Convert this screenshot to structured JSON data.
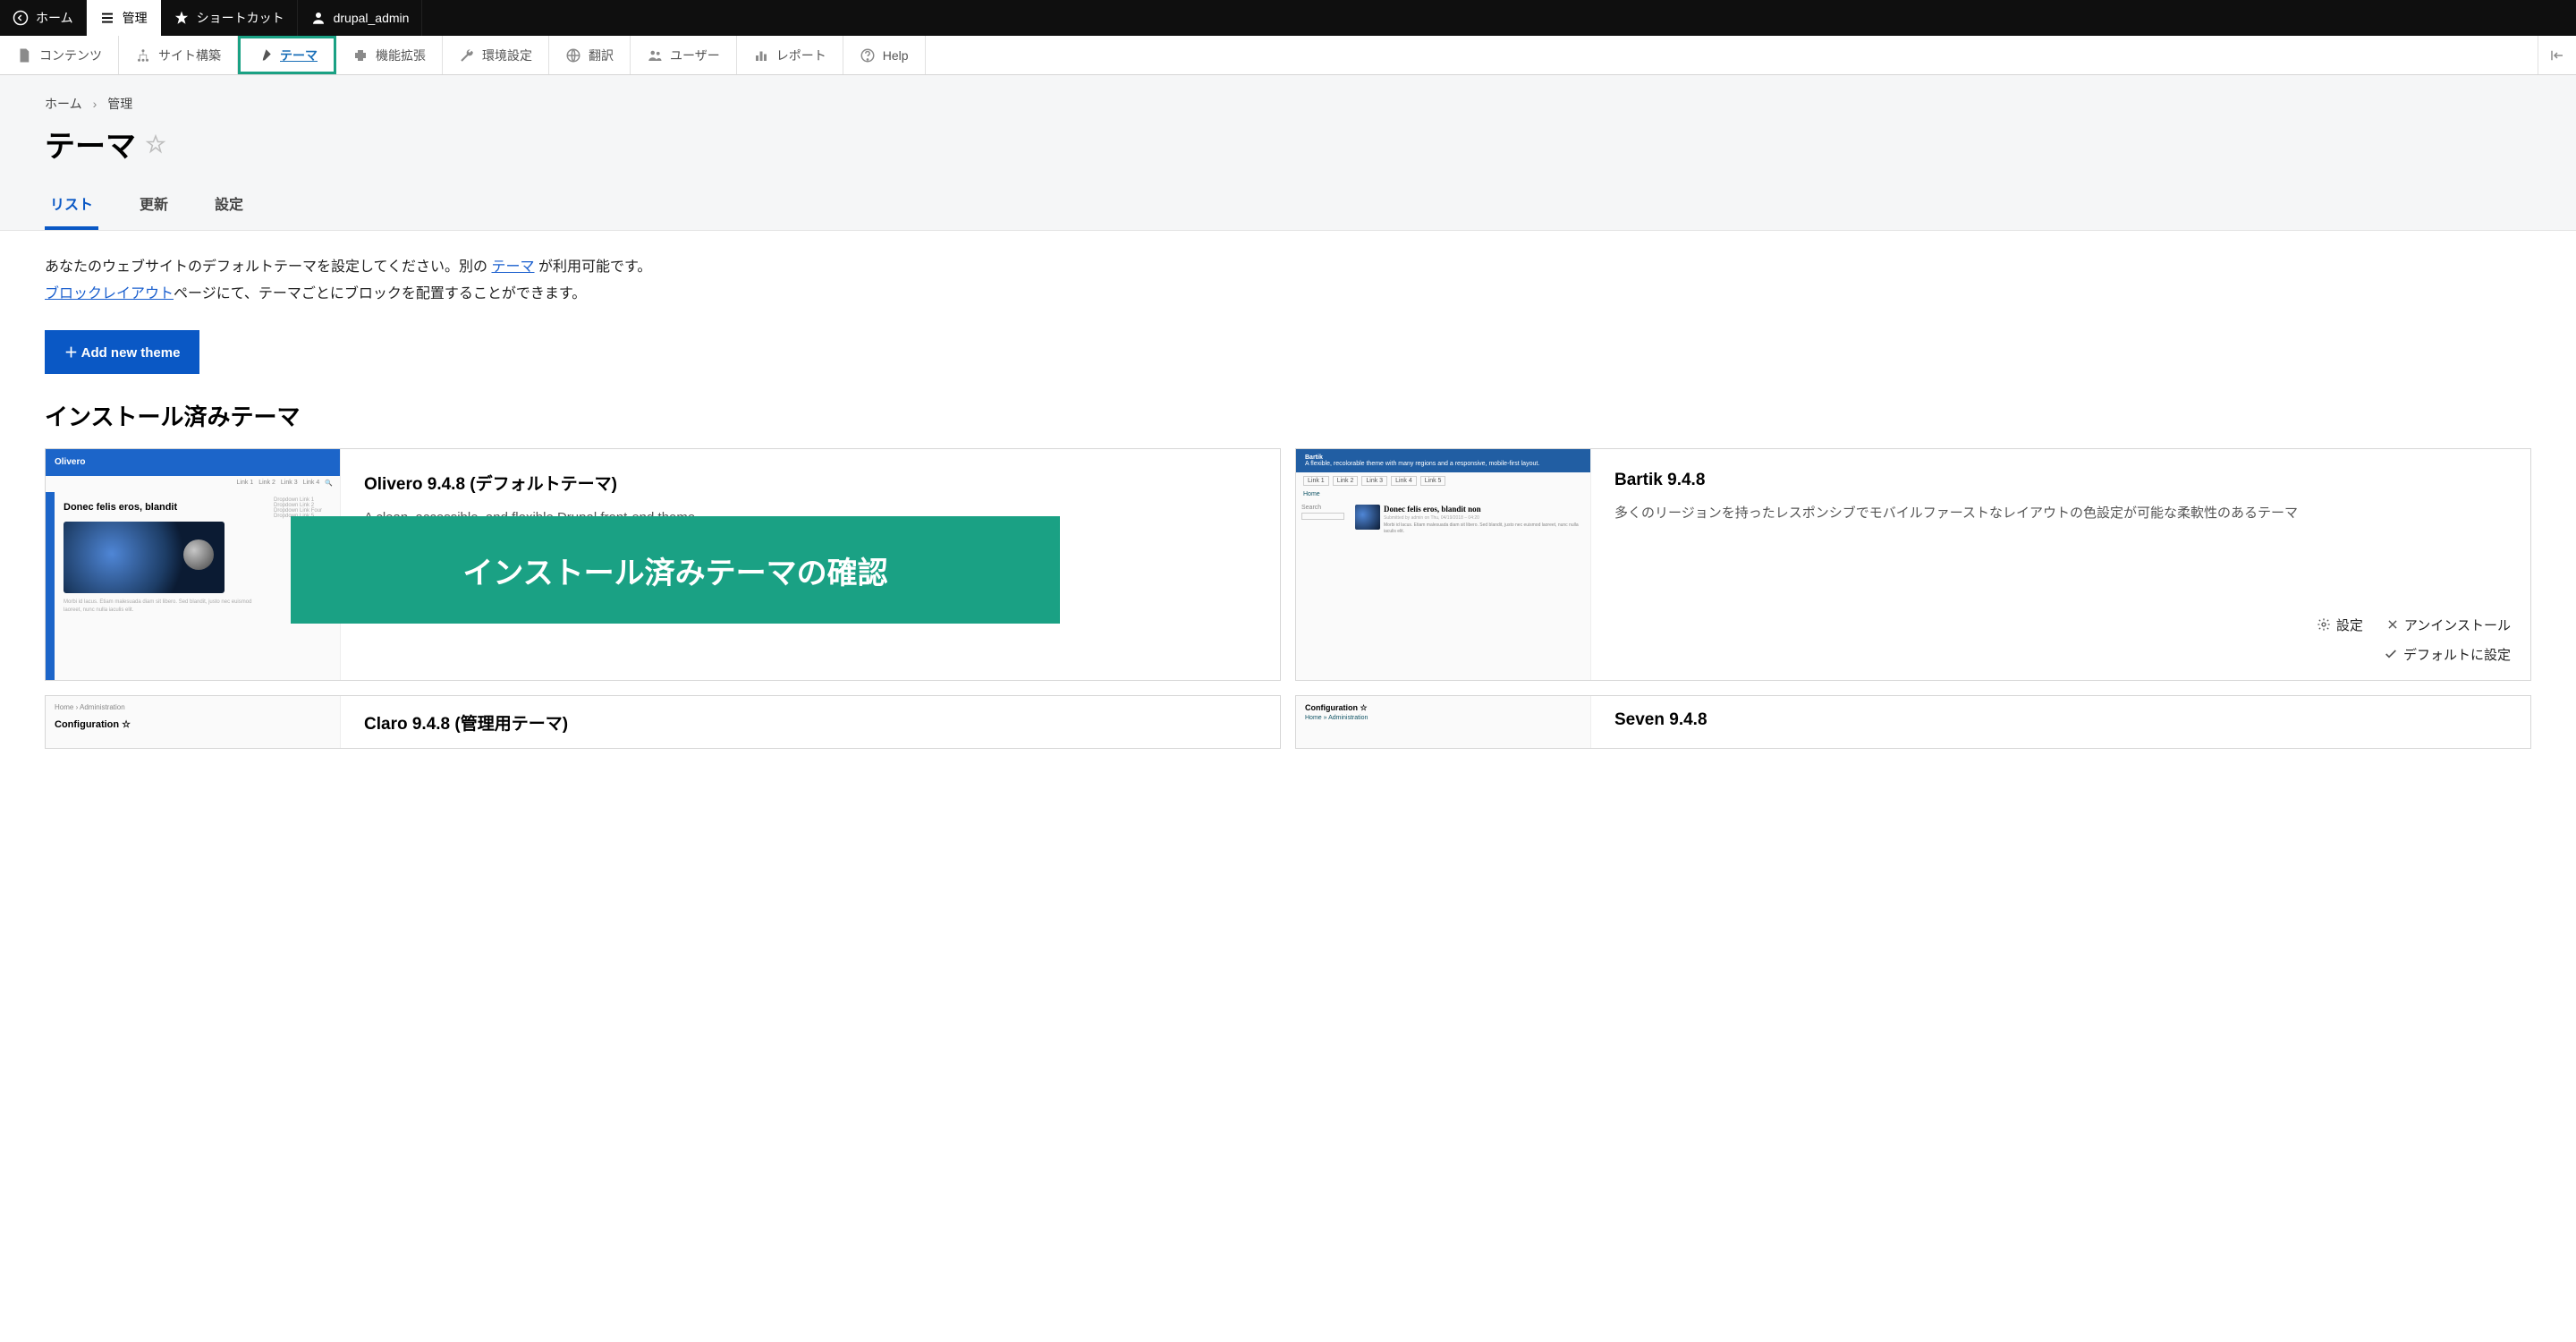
{
  "toolbar": {
    "home": "ホーム",
    "manage": "管理",
    "shortcuts": "ショートカット",
    "user": "drupal_admin"
  },
  "admin_menu": {
    "items": [
      {
        "label": "コンテンツ"
      },
      {
        "label": "サイト構築"
      },
      {
        "label": "テーマ"
      },
      {
        "label": "機能拡張"
      },
      {
        "label": "環境設定"
      },
      {
        "label": "翻訳"
      },
      {
        "label": "ユーザー"
      },
      {
        "label": "レポート"
      },
      {
        "label": "Help"
      }
    ]
  },
  "breadcrumb": {
    "home": "ホーム",
    "sep": "›",
    "manage": "管理"
  },
  "page_title": "テーマ",
  "tabs": {
    "list": "リスト",
    "update": "更新",
    "settings": "設定"
  },
  "desc": {
    "line1_pre": "あなたのウェブサイトのデフォルトテーマを設定してください。別の ",
    "line1_link": "テーマ",
    "line1_post": " が利用可能です。",
    "line2_link": "ブロックレイアウト",
    "line2_post": "ページにて、テーマごとにブロックを配置することができます。"
  },
  "add_button": "＋ Add new theme",
  "installed_heading": "インストール済みテーマ",
  "overlay": "インストール済みテーマの確認",
  "actions": {
    "settings": "設定",
    "uninstall": "アンインストール",
    "set_default": "デフォルトに設定"
  },
  "themes": [
    {
      "name": "Olivero 9.4.8 (デフォルトテーマ)",
      "summary": "A clean, accessible, and flexible Drupal front-end theme."
    },
    {
      "name": "Bartik 9.4.8",
      "summary": "多くのリージョンを持ったレスポンシブでモバイルファーストなレイアウトの色設定が可能な柔軟性のあるテーマ"
    },
    {
      "name": "Claro 9.4.8 (管理用テーマ)",
      "summary": ""
    },
    {
      "name": "Seven 9.4.8",
      "summary": ""
    }
  ],
  "thumb": {
    "olivero": {
      "logo": "Olivero",
      "headline": "Donec felis eros, blandit"
    },
    "bartik": {
      "logo": "Bartik",
      "tagline": "A flexible, recolorable theme with many regions and a responsive, mobile-first layout.",
      "headline": "Donec felis eros, blandit non",
      "home": "Home",
      "search": "Search"
    },
    "claro": {
      "bread": "Home  ›  Administration",
      "title": "Configuration ☆"
    },
    "seven": {
      "title": "Configuration ☆",
      "bread": "Home » Administration"
    }
  }
}
